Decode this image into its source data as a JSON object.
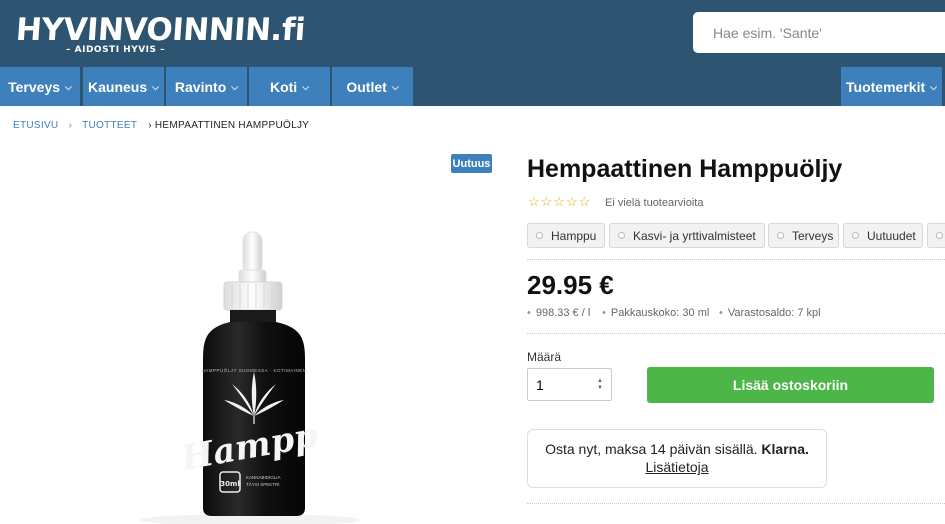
{
  "header": {
    "logo_text": "HYVINVOINNIN.fi",
    "logo_tagline": "– AIDOSTI HYVIS –",
    "search_placeholder": "Hae esim. 'Sante'"
  },
  "nav": {
    "items": [
      {
        "label": "Terveys"
      },
      {
        "label": "Kauneus"
      },
      {
        "label": "Ravinto"
      },
      {
        "label": "Koti"
      },
      {
        "label": "Outlet"
      }
    ],
    "brands_label": "Tuotemerkit",
    "chevron": "⌵"
  },
  "breadcrumb": {
    "home": "ETUSIVU",
    "products": "TUOTTEET",
    "separator": "›",
    "current": "› HEMPAATTINEN HAMPPUÖLJY"
  },
  "product": {
    "badge": "Uutuus",
    "title": "Hempaattinen Hamppuöljy",
    "rating": {
      "stars": 0,
      "max": 5,
      "glyphs": "☆☆☆☆☆",
      "text": "Ei vielä tuotearvioita"
    },
    "tags": [
      "Hamppu",
      "Kasvi- ja yrttivalmisteet",
      "Terveys",
      "Uutuudet"
    ],
    "price": "29.95 €",
    "meta": {
      "bullet": "•",
      "unit_price": "998.33 € / l",
      "package": "Pakkauskoko: 30 ml",
      "stock": "Varastosaldo: 7 kpl"
    },
    "quantity_label": "Määrä",
    "quantity_value": "1",
    "add_to_cart": "Lisää ostoskoriin",
    "klarna": {
      "text": "Osta nyt, maksa 14 päivän sisällä.",
      "brand": "Klarna.",
      "link": "Lisätietoja"
    },
    "bottle": {
      "brand_script": "Hampp",
      "volume": "30ml",
      "top_text": "HAMPPUÖLJY SUOMESSA · KOTIMAINEN",
      "label_line1": "KANNABIDIOLIA",
      "label_line2": "TÄYSI SPEKTRI"
    }
  },
  "colors": {
    "header_bg": "#2d5470",
    "nav_bg": "#3e80bb",
    "add_button": "#4cb648",
    "stars": "#e0b000"
  },
  "icons": {
    "chevron": "chevron-down-icon",
    "spinner": "stepper-arrows-icon",
    "tag_radio": "radio-dot-icon"
  }
}
